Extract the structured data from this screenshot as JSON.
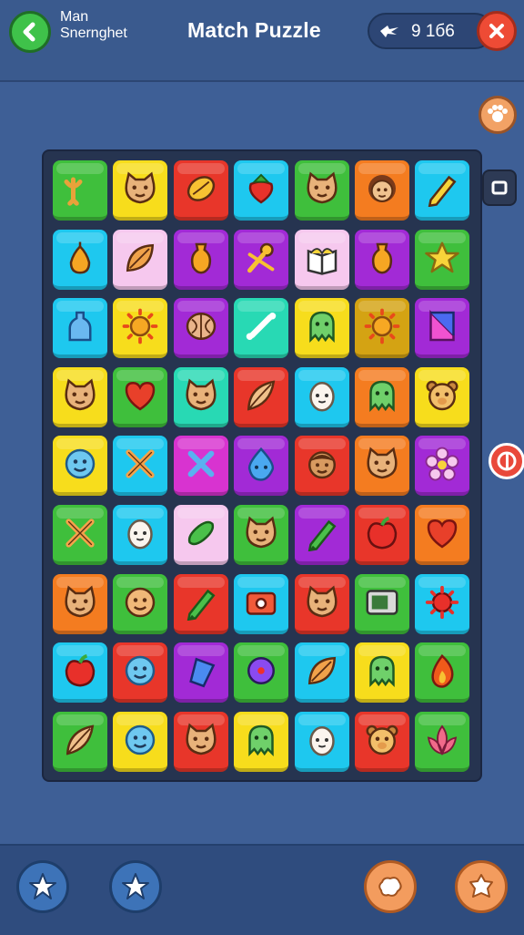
{
  "header": {
    "subtitle_line1": "Man",
    "subtitle_line2": "Snernghet",
    "title": "Match Puzzle",
    "score": "9 1б6"
  },
  "colors": {
    "background": "#3e5f96",
    "board": "#263450",
    "back_button": "#3fc24a",
    "close_button": "#ee4b35"
  },
  "side_buttons": [
    "paw-icon",
    "square-icon",
    "target-icon"
  ],
  "bottom_buttons": [
    "star-icon",
    "star-icon",
    "cookie-icon",
    "cookie-icon"
  ],
  "board": {
    "rows": 9,
    "cols": 7,
    "tiles": [
      [
        "green",
        "trident-icon"
      ],
      [
        "yellow",
        "cat-face-icon"
      ],
      [
        "red",
        "lemon-icon"
      ],
      [
        "cyan",
        "strawberry-icon"
      ],
      [
        "green",
        "cat-face-icon"
      ],
      [
        "orange",
        "girl-face-icon"
      ],
      [
        "cyan",
        "pencil-icon"
      ],
      [
        "cyan",
        "pear-icon"
      ],
      [
        "pink",
        "leaf-icon"
      ],
      [
        "purple",
        "vase-icon"
      ],
      [
        "purple",
        "pin-icon"
      ],
      [
        "pink",
        "book-icon"
      ],
      [
        "purple",
        "vase-icon"
      ],
      [
        "green",
        "star-icon"
      ],
      [
        "cyan",
        "bottle-icon"
      ],
      [
        "yellow",
        "sun-icon"
      ],
      [
        "purple",
        "walnut-icon"
      ],
      [
        "teal",
        "bone-icon"
      ],
      [
        "yellow",
        "ghost-icon"
      ],
      [
        "gold",
        "sun-icon"
      ],
      [
        "purple",
        "ruler-icon"
      ],
      [
        "yellow",
        "cat-face-icon"
      ],
      [
        "green",
        "heart-icon"
      ],
      [
        "teal",
        "cat-face-icon"
      ],
      [
        "red",
        "feather-icon"
      ],
      [
        "cyan",
        "egg-face-icon"
      ],
      [
        "orange",
        "ghost-icon"
      ],
      [
        "yellow",
        "bear-face-icon"
      ],
      [
        "yellow",
        "smile-face-icon"
      ],
      [
        "cyan",
        "cross-icon"
      ],
      [
        "magenta",
        "bone-cross-icon"
      ],
      [
        "purple",
        "drop-face-icon"
      ],
      [
        "red",
        "boy-face-icon"
      ],
      [
        "orange",
        "cat-face-icon"
      ],
      [
        "purple",
        "flower-icon"
      ],
      [
        "green",
        "cross-icon"
      ],
      [
        "cyan",
        "egg-face-icon"
      ],
      [
        "pink",
        "pickle-icon"
      ],
      [
        "green",
        "cat-face-icon"
      ],
      [
        "purple",
        "crayon-icon"
      ],
      [
        "red",
        "apple-icon"
      ],
      [
        "orange",
        "heart-icon"
      ],
      [
        "orange",
        "cat-face-icon"
      ],
      [
        "green",
        "round-face-icon"
      ],
      [
        "red",
        "crayon-icon"
      ],
      [
        "cyan",
        "camera-icon"
      ],
      [
        "red",
        "cat-face-icon"
      ],
      [
        "green",
        "tv-icon"
      ],
      [
        "cyan",
        "virus-icon"
      ],
      [
        "cyan",
        "apple-icon"
      ],
      [
        "red",
        "smile-face-icon"
      ],
      [
        "purple",
        "jar-icon"
      ],
      [
        "green",
        "orb-icon"
      ],
      [
        "cyan",
        "leaf-icon"
      ],
      [
        "yellow",
        "ghost-icon"
      ],
      [
        "green",
        "flame-icon"
      ],
      [
        "green",
        "feather-icon"
      ],
      [
        "yellow",
        "smile-face-icon"
      ],
      [
        "red",
        "cat-face-icon"
      ],
      [
        "yellow",
        "ghost-icon"
      ],
      [
        "cyan",
        "egg-face-icon"
      ],
      [
        "red",
        "bear-face-icon"
      ],
      [
        "green",
        "lotus-icon"
      ]
    ]
  }
}
